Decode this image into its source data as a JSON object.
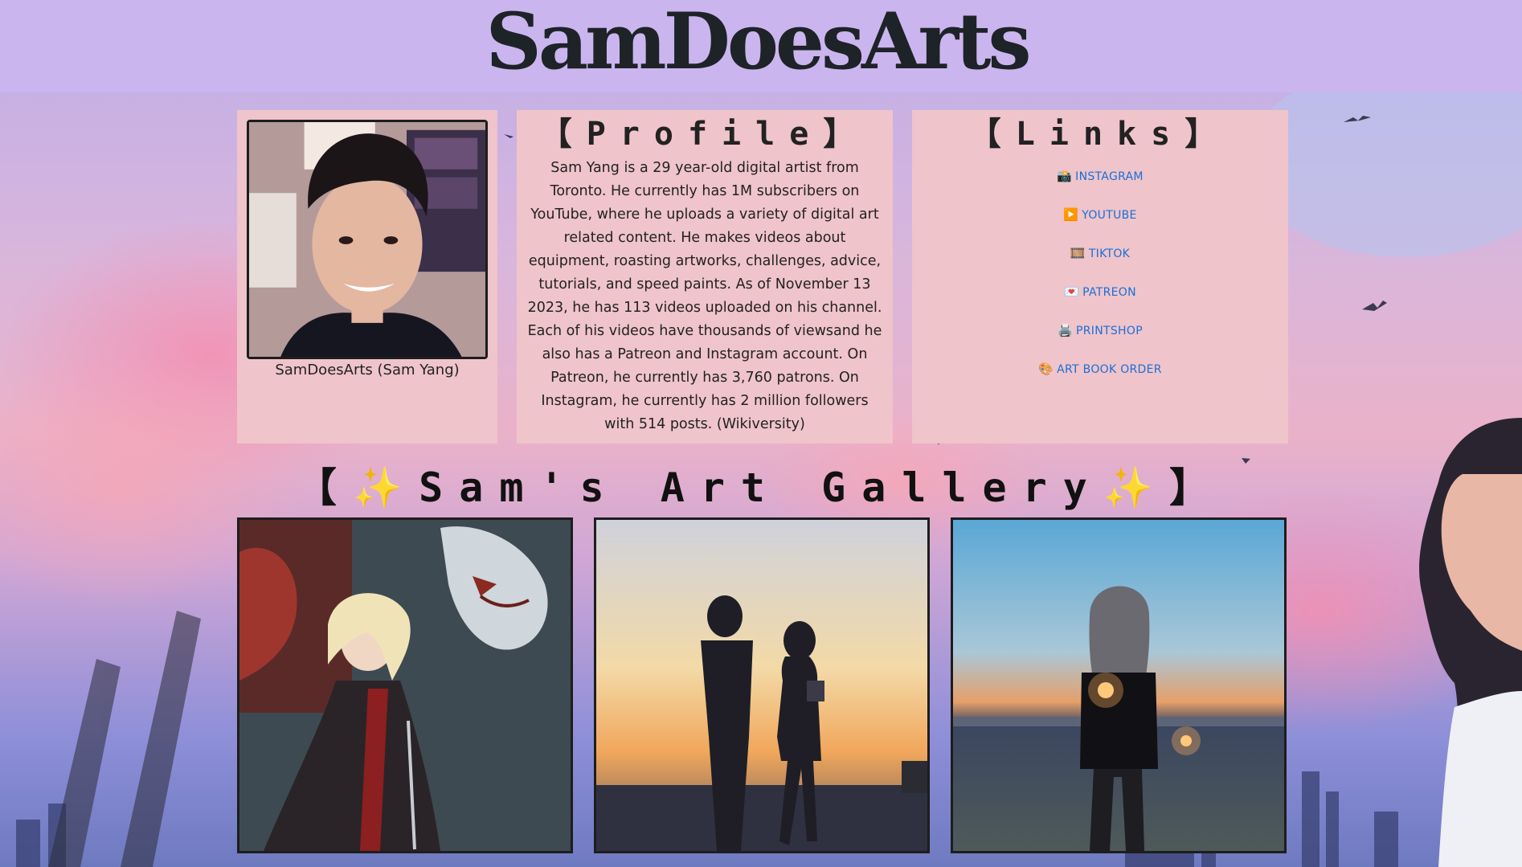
{
  "header": {
    "title": "SamDoesArts"
  },
  "avatar": {
    "caption": "SamDoesArts (Sam Yang)"
  },
  "profile": {
    "heading": "【Profile】",
    "text": "Sam Yang is a 29 year-old digital artist from Toronto. He currently has 1M subscribers on YouTube, where he uploads a variety of digital art related content. He makes videos about equipment, roasting artworks, challenges, advice, tutorials, and speed paints. As of November 13 2023, he has 113 videos uploaded on his channel. Each of his videos have thousands of viewsand he also has a Patreon and Instagram account. On Patreon, he currently has 3,760 patrons. On Instagram, he currently has 2 million followers with 514 posts. (Wikiversity)"
  },
  "links": {
    "heading": "【Links】",
    "items": [
      {
        "icon": "📸",
        "icon_name": "camera-icon",
        "label": "INSTAGRAM"
      },
      {
        "icon": "▶️",
        "icon_name": "play-icon",
        "label": "YOUTUBE"
      },
      {
        "icon": "🎞️",
        "icon_name": "film-icon",
        "label": "TIKTOK"
      },
      {
        "icon": "💌",
        "icon_name": "love-letter-icon",
        "label": "PATREON"
      },
      {
        "icon": "🖨️",
        "icon_name": "printer-icon",
        "label": "PRINTSHOP"
      },
      {
        "icon": "🎨",
        "icon_name": "palette-icon",
        "label": "ART BOOK ORDER"
      }
    ]
  },
  "gallery": {
    "heading": "【✨Sam's Art Gallery✨】"
  },
  "colors": {
    "header_bg": "#cbb5ee",
    "panel_bg": "#efc4ca",
    "link": "#1a6fd8",
    "title": "#1d2327"
  }
}
